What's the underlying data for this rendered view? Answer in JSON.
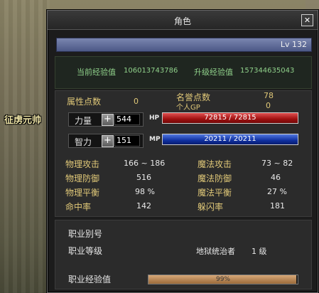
{
  "scene": {
    "character_name": "征虏元帅"
  },
  "window": {
    "title": "角色",
    "close_label": "✕",
    "level": "Lv 132"
  },
  "experience": {
    "current_label": "当前经验值",
    "current_value": "106013743786",
    "next_label": "升级经验值",
    "next_value": "157344635043"
  },
  "points": {
    "attr_label": "属性点数",
    "attr_value": "0",
    "honor_label": "名誉点数",
    "honor_value": "78",
    "gp_label": "个人GP",
    "gp_value": "0"
  },
  "stats": [
    {
      "name": "力量",
      "value": "544",
      "plus": "+",
      "bar_label": "HP",
      "bar_text": "72815 / 72815",
      "bar_fraction": 1.0
    },
    {
      "name": "智力",
      "value": "151",
      "plus": "+",
      "bar_label": "MP",
      "bar_text": "20211 / 20211",
      "bar_fraction": 1.0
    }
  ],
  "combat": {
    "phys_atk_label": "物理攻击",
    "phys_atk": "166 ~ 186",
    "mag_atk_label": "魔法攻击",
    "mag_atk": "73 ~ 82",
    "phys_def_label": "物理防御",
    "phys_def": "516",
    "mag_def_label": "魔法防御",
    "mag_def": "46",
    "phys_bal_label": "物理平衡",
    "phys_bal": "98 %",
    "mag_bal_label": "魔法平衡",
    "mag_bal": "27 %",
    "hit_label": "命中率",
    "hit": "142",
    "dodge_label": "躲闪率",
    "dodge": "181"
  },
  "job": {
    "alias_label": "职业别号",
    "level_label": "职业等级",
    "title": "地狱统治者",
    "level": "1 级",
    "exp_label": "职业经验值",
    "exp_text": "99%",
    "exp_fraction": 0.99
  },
  "colors": {
    "accent_gold": "#e0c878",
    "exp_green": "#8fd08a",
    "hp": "#c02020",
    "mp": "#2040c0"
  }
}
